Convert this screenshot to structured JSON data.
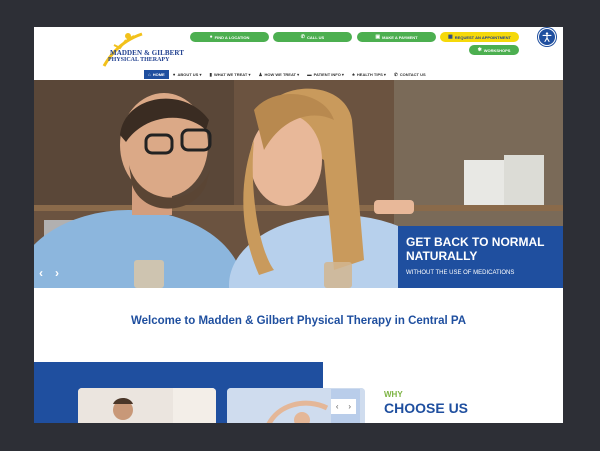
{
  "logo": {
    "line1": "MADDEN & GILBERT",
    "line2": "PHYSICAL THERAPY"
  },
  "top_buttons": [
    {
      "label": "FIND A LOCATION",
      "icon": "map-pin-icon"
    },
    {
      "label": "CALL US",
      "icon": "phone-icon"
    },
    {
      "label": "MAKE A PAYMENT",
      "icon": "payment-icon"
    },
    {
      "label": "REQUEST AN APPOINTMENT",
      "icon": "calendar-icon"
    },
    {
      "label": "WORKSHOPS",
      "icon": "workshop-icon"
    }
  ],
  "nav": [
    {
      "label": "HOME",
      "icon": "home-icon"
    },
    {
      "label": "ABOUT US ▾",
      "icon": "info-icon"
    },
    {
      "label": "WHAT WE TREAT ▾",
      "icon": "clipboard-icon"
    },
    {
      "label": "HOW WE TREAT ▾",
      "icon": "person-icon"
    },
    {
      "label": "PATIENT INFO ▾",
      "icon": "id-card-icon"
    },
    {
      "label": "HEALTH TIPS ▾",
      "icon": "tips-icon"
    },
    {
      "label": "CONTACT US",
      "icon": "contact-icon"
    }
  ],
  "hero": {
    "title": "GET BACK TO NORMAL NATURALLY",
    "subtitle": "WITHOUT THE USE OF MEDICATIONS"
  },
  "welcome": "Welcome to Madden & Gilbert Physical Therapy in Central PA",
  "why": {
    "small": "WHY",
    "big": "CHOOSE US"
  },
  "colors": {
    "brand_blue": "#1f4f9f",
    "green": "#4caf50",
    "yellow": "#f5d90a",
    "why_green": "#7cb342"
  }
}
